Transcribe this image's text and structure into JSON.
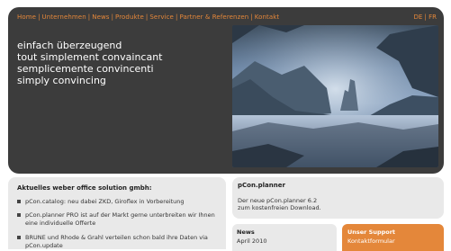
{
  "nav": {
    "items": [
      "Home",
      "Unternehmen",
      "News",
      "Produkte",
      "Service",
      "Partner & Referenzen",
      "Kontakt"
    ],
    "separator": "|"
  },
  "lang": {
    "de": "DE",
    "sep": "|",
    "fr": "FR"
  },
  "tagline": {
    "lines": [
      "einfach überzeugend",
      "tout simplement convaincant",
      "semplicemente convincenti",
      "simply convincing"
    ]
  },
  "news_list": {
    "title": "Aktuelles weber office solution gmbh:",
    "items": [
      {
        "line1": "pCon.catalog: neu dabei ZKD, Giroflex in Vorbereitung",
        "line2": ""
      },
      {
        "line1": "pCon.planner PRO ist auf der Markt gerne unterbreiten wir Ihnen",
        "line2": "eine individuelle Offerte"
      },
      {
        "line1": "BRUNE und Rhode & Grahl verteilen schon bald ihre Daten via",
        "line2": "pCon.update"
      }
    ]
  },
  "planner_box": {
    "title": "pCon.planner",
    "line1": "Der neue pCon.planner 6.2",
    "line2": "zum kostenfreien Download."
  },
  "news_box": {
    "title": "News",
    "date": "April 2010"
  },
  "support_box": {
    "title": "Unser Support",
    "link": "Kontaktformular"
  },
  "colors": {
    "accent": "#e4873a",
    "header_bg": "#3c3c3c",
    "panel_bg": "#e9e9e9"
  }
}
